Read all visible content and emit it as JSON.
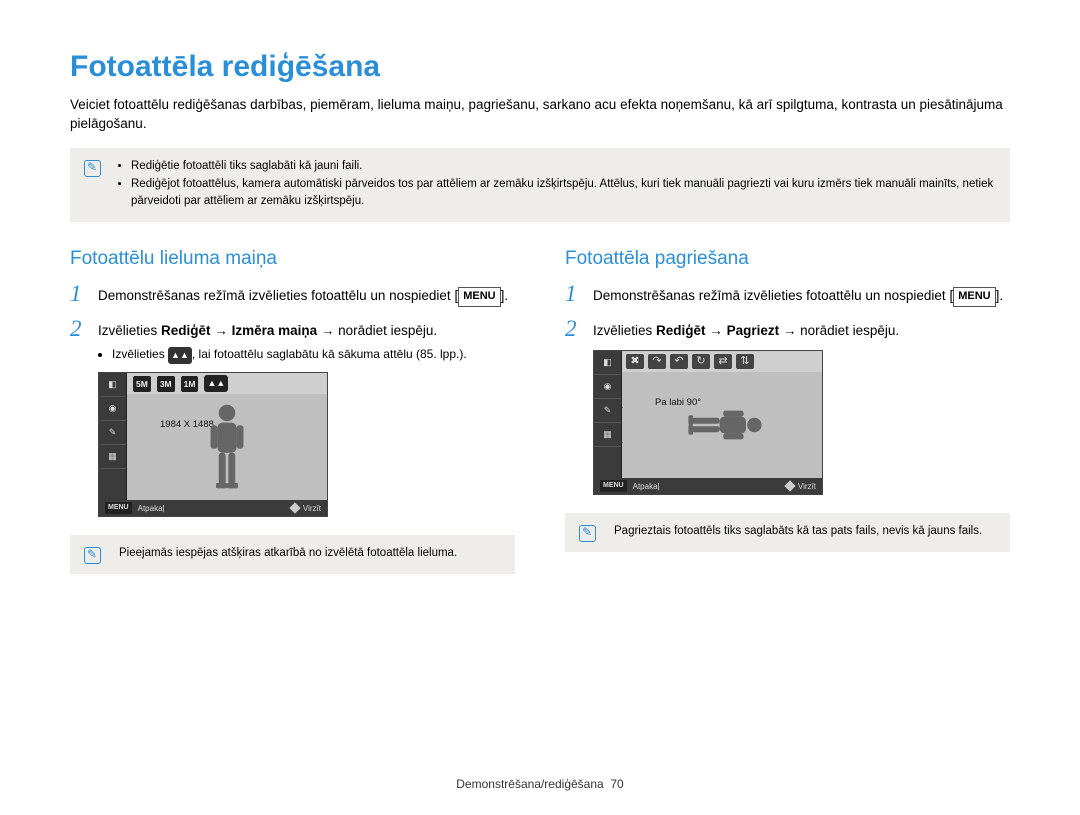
{
  "title": "Fotoattēla rediģēšana",
  "intro": "Veiciet fotoattēlu rediģēšanas darbības, piemēram, lieluma maiņu, pagriešanu, sarkano acu efekta noņemšanu, kā arī spilgtuma, kontrasta un piesātinājuma pielāgošanu.",
  "top_notes": [
    "Rediģētie fotoattēli tiks saglabāti kā jauni faili.",
    "Rediģējot fotoattēlus, kamera automātiski pārveidos tos par attēliem ar zemāku izšķirtspēju. Attēlus, kuri tiek manuāli pagriezti vai kuru izmērs tiek manuāli mainīts, netiek pārveidoti par attēliem ar zemāku izšķirtspēju."
  ],
  "left": {
    "heading": "Fotoattēlu lieluma maiņa",
    "step1": "Demonstrēšanas režīmā izvēlieties fotoattēlu un nospiediet",
    "menu_label": "MENU",
    "step2_pre": "Izvēlieties ",
    "step2_b1": "Rediģēt",
    "step2_arrow": " → ",
    "step2_b2": "Izmēra maiņa",
    "step2_post": " → norādiet iespēju.",
    "sub_pre": "Izvēlieties ",
    "sub_post": ", lai fotoattēlu saglabātu kā sākuma attēlu (85. lpp.).",
    "lcd": {
      "chips": [
        "5M",
        "3M",
        "1M"
      ],
      "dim": "1984 X 1488",
      "bottom_menu": "MENU",
      "bottom_back": "Atpakaļ",
      "bottom_move": "Virzīt"
    },
    "note": "Pieejamās iespējas atšķiras atkarībā no izvēlētā fotoattēla lieluma."
  },
  "right": {
    "heading": "Fotoattēla pagriešana",
    "step1": "Demonstrēšanas režīmā izvēlieties fotoattēlu un nospiediet",
    "menu_label": "MENU",
    "step2_pre": "Izvēlieties ",
    "step2_b1": "Rediģēt",
    "step2_arrow": " → ",
    "step2_b2": "Pagriezt",
    "step2_post": " → norādiet iespēju.",
    "lcd": {
      "label": "Pa labi 90°",
      "bottom_menu": "MENU",
      "bottom_back": "Atpakaļ",
      "bottom_move": "Virzīt"
    },
    "note": "Pagrieztais fotoattēls tiks saglabāts kā tas pats fails, nevis kā jauns fails."
  },
  "footer_section": "Demonstrēšana/rediģēšana",
  "footer_page": "70"
}
